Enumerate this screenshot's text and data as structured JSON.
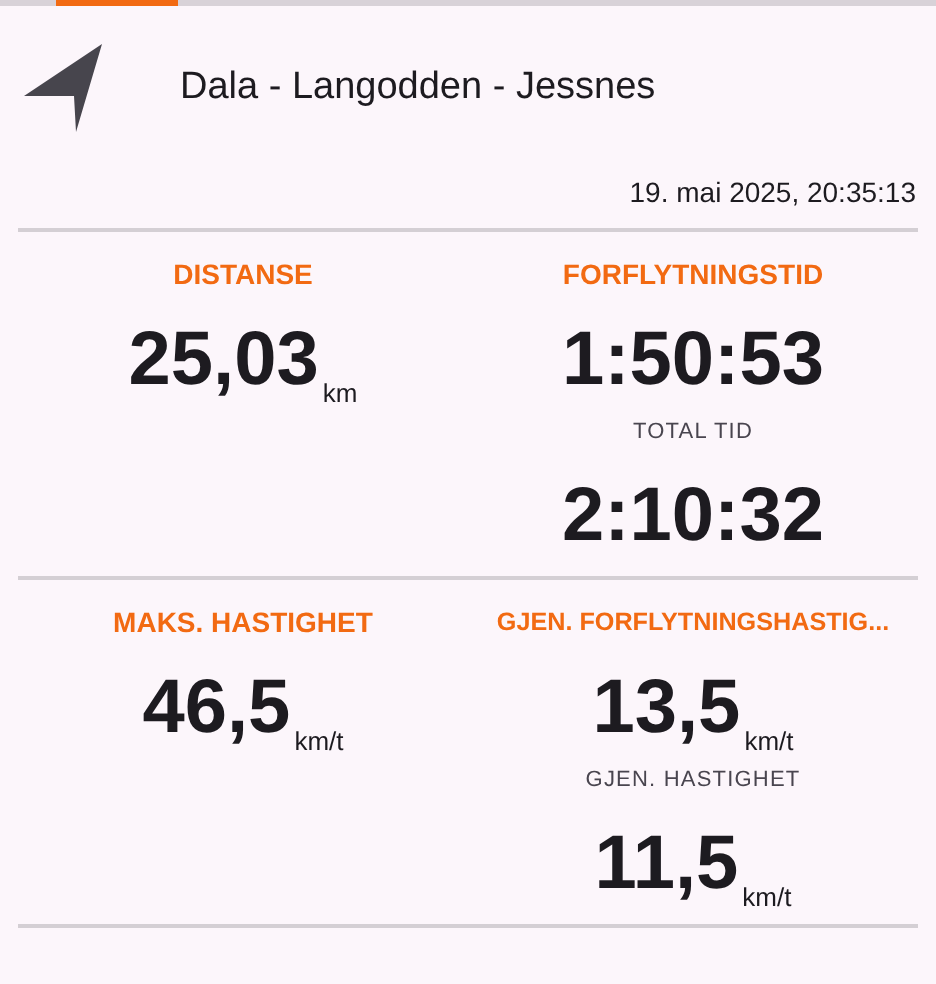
{
  "header": {
    "title": "Dala - Langodden - Jessnes",
    "date": "19. mai 2025, 20:35:13"
  },
  "sections": [
    {
      "columns": [
        {
          "heading": "DISTANSE",
          "value": "25,03",
          "unit": "km"
        },
        {
          "heading": "FORFLYTNINGSTID",
          "value": "1:50:53",
          "secondary": {
            "label": "TOTAL TID",
            "value": "2:10:32"
          }
        }
      ]
    },
    {
      "columns": [
        {
          "heading": "MAKS. HASTIGHET",
          "value": "46,5",
          "unit": "km/t"
        },
        {
          "heading": "GJEN. FORFLYTNINGSHASTIG...",
          "value": "13,5",
          "unit": "km/t",
          "secondary": {
            "label": "GJEN. HASTIGHET",
            "value": "11,5",
            "unit": "km/t"
          }
        }
      ]
    }
  ]
}
